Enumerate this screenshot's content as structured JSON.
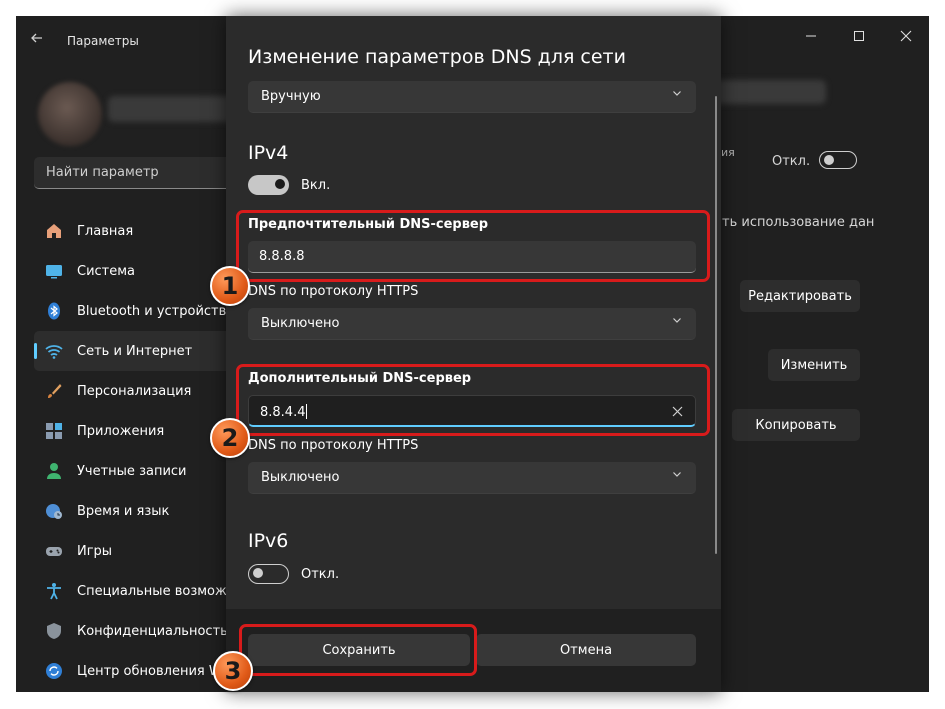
{
  "window": {
    "title": "Параметры",
    "back_icon": "arrow-left-icon",
    "controls": [
      "minimize-icon",
      "maximize-icon",
      "close-icon"
    ]
  },
  "sidebar": {
    "search_placeholder": "Найти параметр",
    "items": [
      {
        "label": "Главная",
        "icon": "home-icon",
        "active": false
      },
      {
        "label": "Система",
        "icon": "monitor-icon",
        "active": false
      },
      {
        "label": "Bluetooth и устройства",
        "icon": "bluetooth-icon",
        "active": false
      },
      {
        "label": "Сеть и Интернет",
        "icon": "wifi-icon",
        "active": true
      },
      {
        "label": "Персонализация",
        "icon": "brush-icon",
        "active": false
      },
      {
        "label": "Приложения",
        "icon": "apps-icon",
        "active": false
      },
      {
        "label": "Учетные записи",
        "icon": "person-icon",
        "active": false
      },
      {
        "label": "Время и язык",
        "icon": "globe-clock-icon",
        "active": false
      },
      {
        "label": "Игры",
        "icon": "gamepad-icon",
        "active": false
      },
      {
        "label": "Специальные возможно",
        "icon": "accessibility-icon",
        "active": false
      },
      {
        "label": "Конфиденциальность и",
        "icon": "shield-icon",
        "active": false
      },
      {
        "label": "Центр обновления W",
        "icon": "update-icon",
        "active": false
      }
    ]
  },
  "background": {
    "metered_partial": "ия",
    "toggle_label": "Откл.",
    "usage_text": "ть использование дан",
    "edit_button": "Редактировать",
    "change_button": "Изменить",
    "copy_button": "Копировать"
  },
  "dialog": {
    "title": "Изменение параметров DNS для сети",
    "mode": "Вручную",
    "ipv4": {
      "heading": "IPv4",
      "toggle_label": "Вкл.",
      "toggle_on": true,
      "preferred_label": "Предпочтительный DNS-сервер",
      "preferred_value": "8.8.8.8",
      "preferred_https_label": "DNS по протоколу HTTPS",
      "preferred_https_value": "Выключено",
      "alternate_label": "Дополнительный DNS-сервер",
      "alternate_value": "8.8.4.4",
      "alternate_https_label": "DNS по протоколу HTTPS",
      "alternate_https_value": "Выключено"
    },
    "ipv6": {
      "heading": "IPv6",
      "toggle_label": "Откл.",
      "toggle_on": false
    },
    "save_button": "Сохранить",
    "cancel_button": "Отмена"
  },
  "annotations": {
    "badges": [
      "1",
      "2",
      "3"
    ],
    "highlight_color": "#d81b1b",
    "badge_color": "#e86a25"
  },
  "colors": {
    "accent": "#60cdff",
    "window_bg": "#202020",
    "dialog_bg": "#2b2b2b"
  }
}
